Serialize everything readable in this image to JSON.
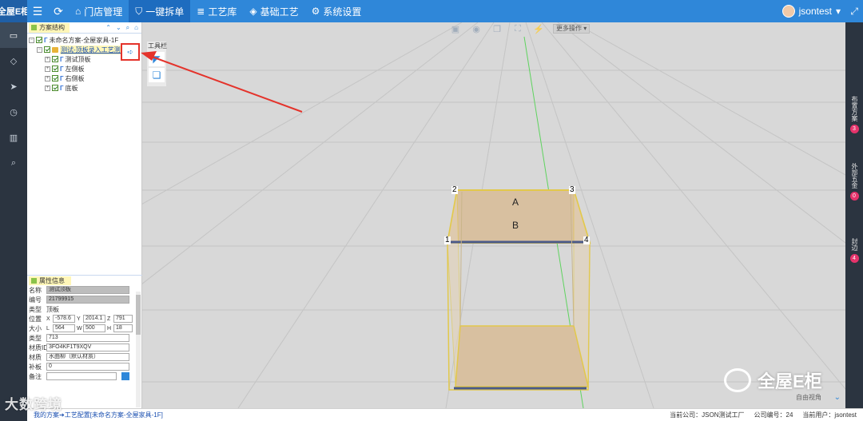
{
  "app": {
    "logo_text": "全屋E柜",
    "colors": {
      "topbar": "#2f87d9",
      "accent_red": "#e4332b",
      "panel_bg": "#ffffff",
      "rail_bg": "#2b3440"
    }
  },
  "topbar": {
    "menu_icon": "menu-icon",
    "refresh_icon": "refresh-icon",
    "nav": [
      {
        "label": "门店管理",
        "icon": "store-icon",
        "active": false
      },
      {
        "label": "一键拆单",
        "icon": "shield-icon",
        "active": true
      },
      {
        "label": "工艺库",
        "icon": "library-icon",
        "active": false
      },
      {
        "label": "基础工艺",
        "icon": "package-icon",
        "active": false
      },
      {
        "label": "系统设置",
        "icon": "gear-icon",
        "active": false
      }
    ],
    "user_name": "jsontest",
    "fullscreen_icon": "fullscreen-icon"
  },
  "tree_panel": {
    "title": "方案结构",
    "root_label": "未命名方案-全屋家具-1F",
    "selected_label": "测试-顶板录入工艺测试",
    "children": [
      "测试顶板",
      "左侧板",
      "右侧板",
      "底板"
    ]
  },
  "toolbox": {
    "title": "工具栏"
  },
  "canvas_toolbar": {
    "more_label": "更多操作"
  },
  "model": {
    "corner_labels": [
      "2",
      "3",
      "1",
      "4"
    ],
    "face_labels": [
      "A",
      "B"
    ]
  },
  "props": {
    "title": "属性信息",
    "name_label": "名称",
    "name_value": "测试顶板",
    "code_label": "编号",
    "code_value": "21799915",
    "type_label": "类型",
    "type_value": "顶板",
    "pos_label": "位置",
    "pos_x": "-578.6",
    "pos_y": "2014.1",
    "pos_z": "791",
    "size_label": "大小",
    "size_l": "564",
    "size_w": "500",
    "size_h": "18",
    "kind_label": "类型",
    "kind_value": "713",
    "matid_label": "材质ID",
    "matid_value": "3FO4KF1T9XQV",
    "mat_label": "材质",
    "mat_value": "水曲柳（默认材质）",
    "patch_label": "补板",
    "patch_value": "0",
    "note_label": "备注",
    "note_value": ""
  },
  "right_rail": [
    {
      "label": "布置方案",
      "badge": "3"
    },
    {
      "label": "外部五金",
      "badge": "0"
    },
    {
      "label": "封边",
      "badge": "4"
    }
  ],
  "view": {
    "label": "自由视角"
  },
  "status": {
    "breadcrumb": "我的方案➔工艺配置[未命名方案-全屋家具-1F]",
    "company": "当前公司：JSON测试工厂",
    "company_no": "公司编号：24",
    "user": "当前用户：jsontest"
  },
  "watermarks": {
    "left": "大数跨境",
    "right": "全屋E柜"
  }
}
